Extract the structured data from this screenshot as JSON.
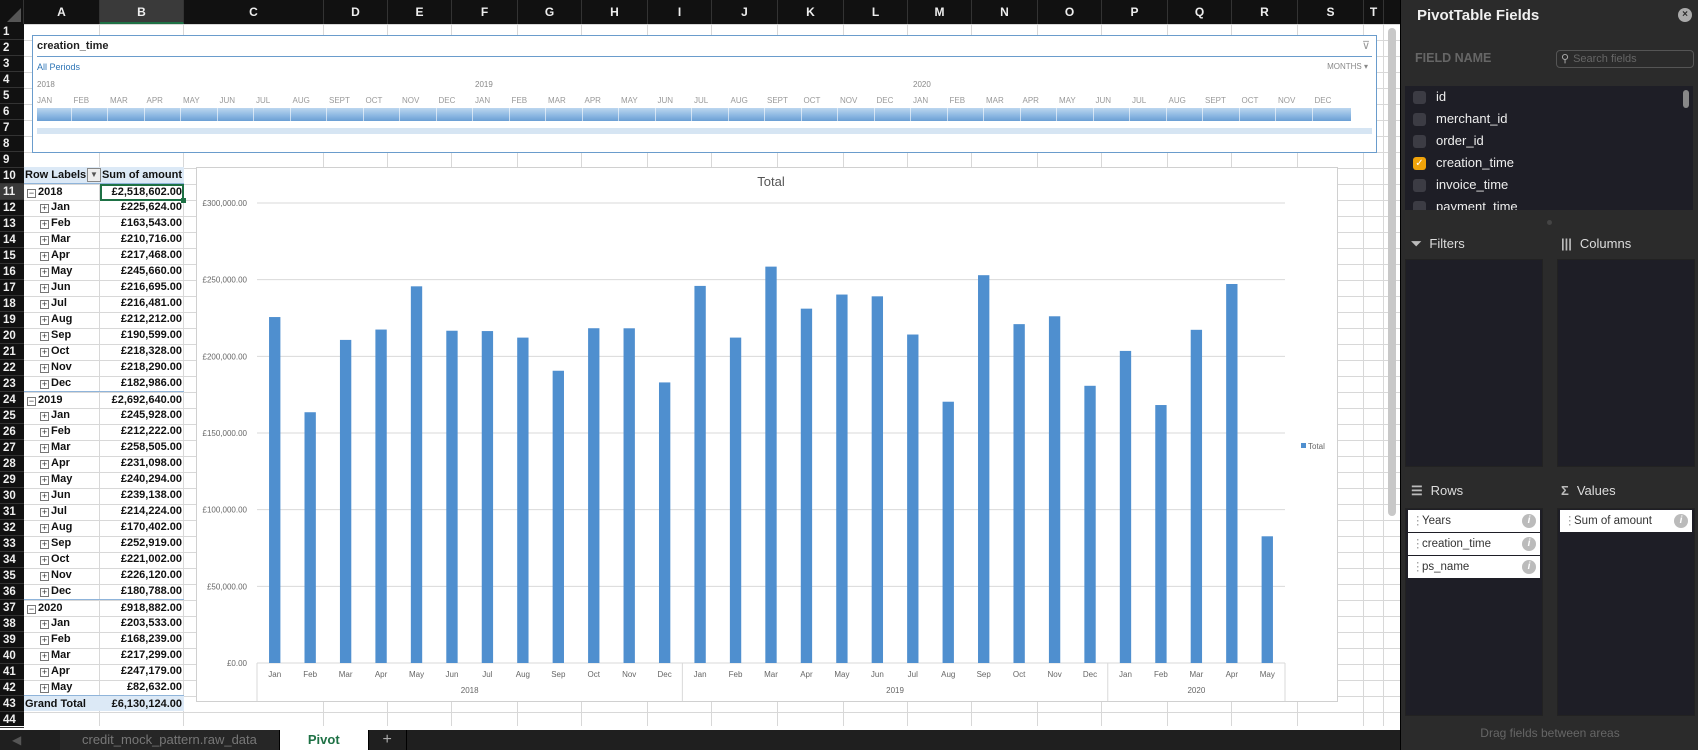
{
  "sheet": {
    "columns": [
      "A",
      "B",
      "C",
      "D",
      "E",
      "F",
      "G",
      "H",
      "I",
      "J",
      "K",
      "L",
      "M",
      "N",
      "O",
      "P",
      "Q",
      "R",
      "S",
      "T"
    ],
    "selected_column": "B",
    "rows": [
      "1",
      "2",
      "3",
      "4",
      "5",
      "6",
      "7",
      "8",
      "9",
      "10",
      "11",
      "12",
      "13",
      "14",
      "15",
      "16",
      "17",
      "18",
      "19",
      "20",
      "21",
      "22",
      "23",
      "24",
      "25",
      "26",
      "27",
      "28",
      "29",
      "30",
      "31",
      "32",
      "33",
      "34",
      "35",
      "36",
      "37",
      "38",
      "39",
      "40",
      "41",
      "42",
      "43",
      "44"
    ],
    "selected_row": "11"
  },
  "slicer": {
    "title": "creation_time",
    "clear_filter_icon": "clear-filter-icon",
    "all_periods": "All Periods",
    "time_level": "MONTHS ▾",
    "years": [
      "2018",
      "2019",
      "2020"
    ],
    "months": [
      "JAN",
      "FEB",
      "MAR",
      "APR",
      "MAY",
      "JUN",
      "JUL",
      "AUG",
      "SEPT",
      "OCT",
      "NOV",
      "DEC",
      "JAN",
      "FEB",
      "MAR",
      "APR",
      "MAY",
      "JUN",
      "JUL",
      "AUG",
      "SEPT",
      "OCT",
      "NOV",
      "DEC",
      "JAN",
      "FEB",
      "MAR",
      "APR",
      "MAY",
      "JUN",
      "JUL",
      "AUG",
      "SEPT",
      "OCT",
      "NOV",
      "DEC"
    ]
  },
  "pivot": {
    "header_row_labels": "Row Labels",
    "header_sum": "Sum of amount",
    "groups": [
      {
        "year": "2018",
        "total": "£2,518,602.00",
        "months": [
          {
            "m": "Jan",
            "v": "£225,624.00"
          },
          {
            "m": "Feb",
            "v": "£163,543.00"
          },
          {
            "m": "Mar",
            "v": "£210,716.00"
          },
          {
            "m": "Apr",
            "v": "£217,468.00"
          },
          {
            "m": "May",
            "v": "£245,660.00"
          },
          {
            "m": "Jun",
            "v": "£216,695.00"
          },
          {
            "m": "Jul",
            "v": "£216,481.00"
          },
          {
            "m": "Aug",
            "v": "£212,212.00"
          },
          {
            "m": "Sep",
            "v": "£190,599.00"
          },
          {
            "m": "Oct",
            "v": "£218,328.00"
          },
          {
            "m": "Nov",
            "v": "£218,290.00"
          },
          {
            "m": "Dec",
            "v": "£182,986.00"
          }
        ]
      },
      {
        "year": "2019",
        "total": "£2,692,640.00",
        "months": [
          {
            "m": "Jan",
            "v": "£245,928.00"
          },
          {
            "m": "Feb",
            "v": "£212,222.00"
          },
          {
            "m": "Mar",
            "v": "£258,505.00"
          },
          {
            "m": "Apr",
            "v": "£231,098.00"
          },
          {
            "m": "May",
            "v": "£240,294.00"
          },
          {
            "m": "Jun",
            "v": "£239,138.00"
          },
          {
            "m": "Jul",
            "v": "£214,224.00"
          },
          {
            "m": "Aug",
            "v": "£170,402.00"
          },
          {
            "m": "Sep",
            "v": "£252,919.00"
          },
          {
            "m": "Oct",
            "v": "£221,002.00"
          },
          {
            "m": "Nov",
            "v": "£226,120.00"
          },
          {
            "m": "Dec",
            "v": "£180,788.00"
          }
        ]
      },
      {
        "year": "2020",
        "total": "£918,882.00",
        "months": [
          {
            "m": "Jan",
            "v": "£203,533.00"
          },
          {
            "m": "Feb",
            "v": "£168,239.00"
          },
          {
            "m": "Mar",
            "v": "£217,299.00"
          },
          {
            "m": "Apr",
            "v": "£247,179.00"
          },
          {
            "m": "May",
            "v": "£82,632.00"
          }
        ]
      }
    ],
    "grand_total_label": "Grand Total",
    "grand_total": "£6,130,124.00"
  },
  "chart_data": {
    "type": "bar",
    "title": "Total",
    "xlabel": "",
    "ylabel": "",
    "ylim": [
      0,
      300000
    ],
    "yticks": [
      0,
      50000,
      100000,
      150000,
      200000,
      250000,
      300000
    ],
    "ytick_labels": [
      "£0.00",
      "£50,000.00",
      "£100,000.00",
      "£150,000.00",
      "£200,000.00",
      "£250,000.00",
      "£300,000.00"
    ],
    "grid": true,
    "legend": "right",
    "categories": [
      "Jan",
      "Feb",
      "Mar",
      "Apr",
      "May",
      "Jun",
      "Jul",
      "Aug",
      "Sep",
      "Oct",
      "Nov",
      "Dec",
      "Jan",
      "Feb",
      "Mar",
      "Apr",
      "May",
      "Jun",
      "Jul",
      "Aug",
      "Sep",
      "Oct",
      "Nov",
      "Dec",
      "Jan",
      "Feb",
      "Mar",
      "Apr",
      "May"
    ],
    "category_groups": [
      {
        "label": "2018",
        "count": 12
      },
      {
        "label": "2019",
        "count": 12
      },
      {
        "label": "2020",
        "count": 5
      }
    ],
    "series": [
      {
        "name": "Total",
        "color": "#4f8fcf",
        "values": [
          225624,
          163543,
          210716,
          217468,
          245660,
          216695,
          216481,
          212212,
          190599,
          218328,
          218290,
          182986,
          245928,
          212222,
          258505,
          231098,
          240294,
          239138,
          214224,
          170402,
          252919,
          221002,
          226120,
          180788,
          203533,
          168239,
          217299,
          247179,
          82632
        ]
      }
    ]
  },
  "tabs": {
    "nav_icons": "◀ ▶",
    "items": [
      {
        "label": "credit_mock_pattern.raw_data",
        "active": false
      },
      {
        "label": "Pivot",
        "active": true
      }
    ],
    "add_label": "+"
  },
  "panel": {
    "title": "PivotTable Fields",
    "close_icon": "×",
    "field_name_label": "FIELD NAME",
    "search_placeholder": "Search fields",
    "fields": [
      {
        "name": "id",
        "checked": false
      },
      {
        "name": "merchant_id",
        "checked": false
      },
      {
        "name": "order_id",
        "checked": false
      },
      {
        "name": "creation_time",
        "checked": true
      },
      {
        "name": "invoice_time",
        "checked": false
      },
      {
        "name": "payment_time",
        "checked": false
      }
    ],
    "filters_label": "Filters",
    "columns_label": "Columns",
    "rows_label": "Rows",
    "values_label": "Values",
    "rows_items": [
      "Years",
      "creation_time",
      "ps_name"
    ],
    "values_items": [
      "Sum of amount"
    ],
    "hint": "Drag fields between areas"
  }
}
